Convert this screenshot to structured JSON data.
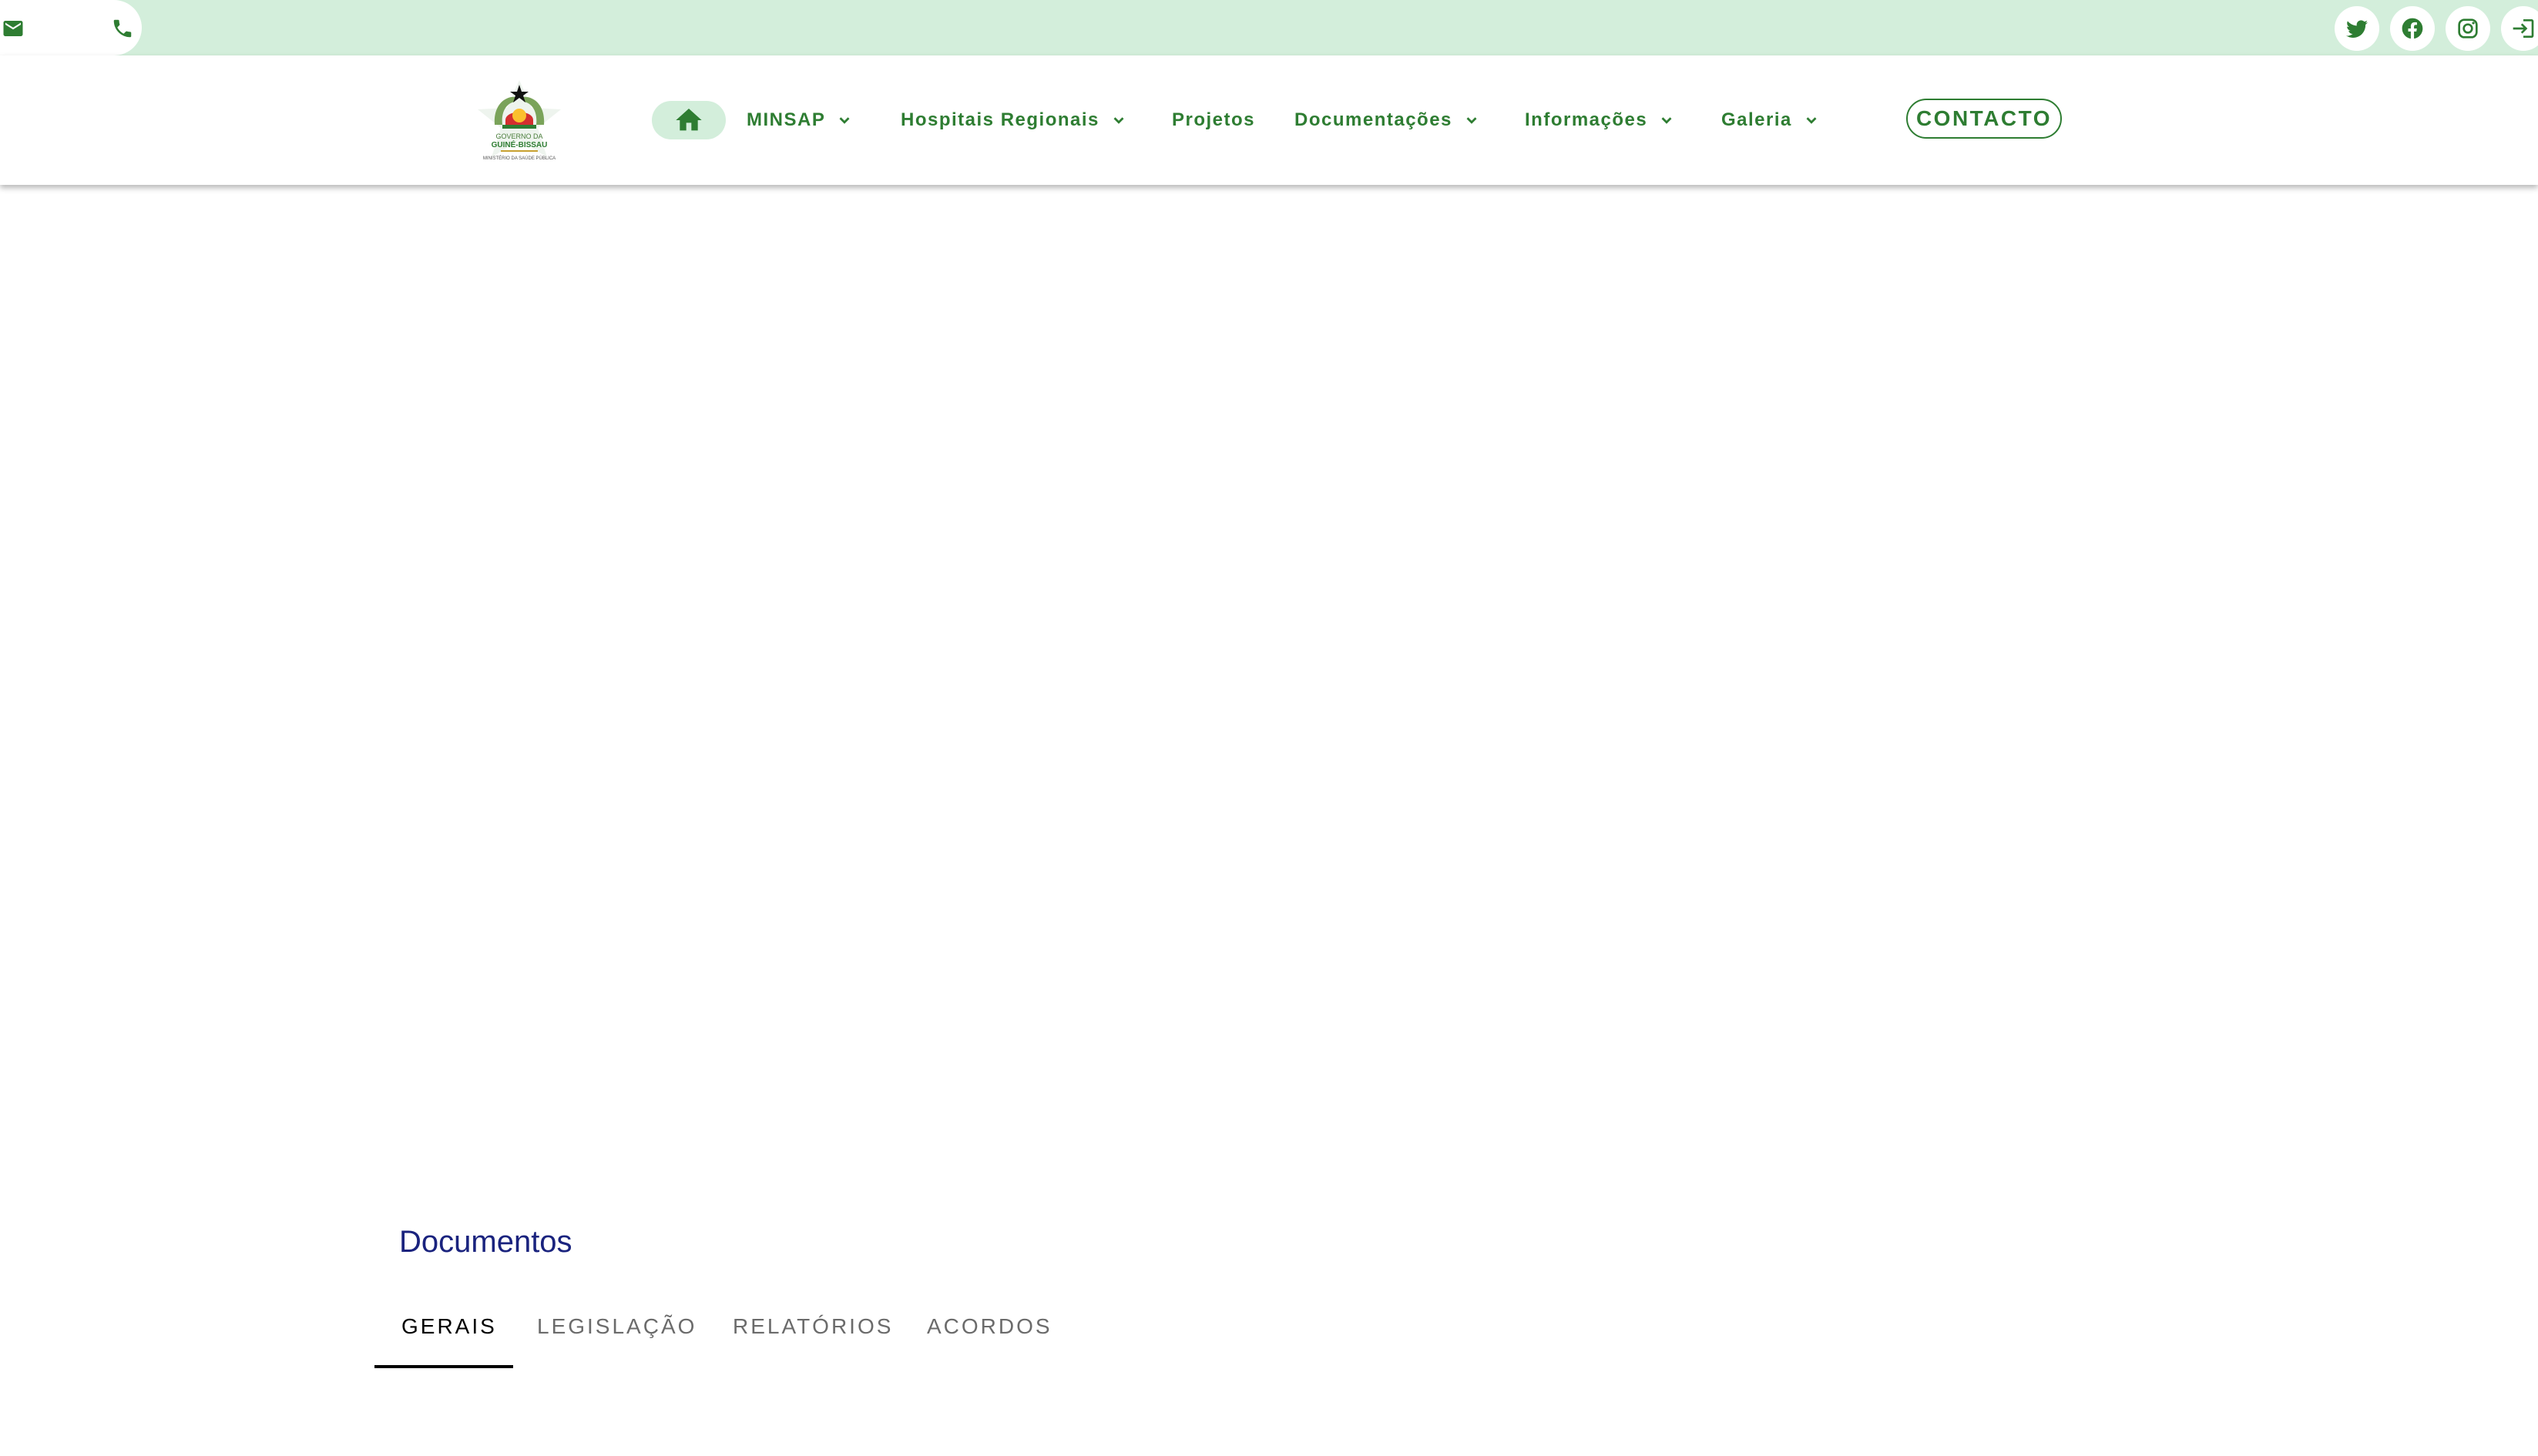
{
  "colors": {
    "accent": "#2e7d32",
    "topbar_bg": "#d3eedb",
    "title": "#1a237e"
  },
  "topbar": {
    "left_icons": [
      "mail-icon",
      "phone-icon"
    ],
    "social_icons": [
      "twitter-icon",
      "facebook-icon",
      "instagram-icon",
      "login-icon"
    ]
  },
  "logo": {
    "line1": "GOVERNO DA",
    "line2": "GUINÉ-BISSAU",
    "line3": "MINISTÉRIO DA SAÚDE PÚBLICA"
  },
  "nav": {
    "home_icon": "home-icon",
    "items": [
      {
        "label": "MINSAP",
        "has_dropdown": true
      },
      {
        "label": "Hospitais Regionais",
        "has_dropdown": true
      },
      {
        "label": "Projetos",
        "has_dropdown": false
      },
      {
        "label": "Documentações",
        "has_dropdown": true
      },
      {
        "label": "Informações",
        "has_dropdown": true
      },
      {
        "label": "Galeria",
        "has_dropdown": true
      }
    ],
    "contact_label": "CONTACTO"
  },
  "documents": {
    "title": "Documentos",
    "tabs": [
      {
        "label": "GERAIS",
        "active": true
      },
      {
        "label": "LEGISLAÇÃO",
        "active": false
      },
      {
        "label": "RELATÓRIOS",
        "active": false
      },
      {
        "label": "ACORDOS",
        "active": false
      }
    ]
  }
}
